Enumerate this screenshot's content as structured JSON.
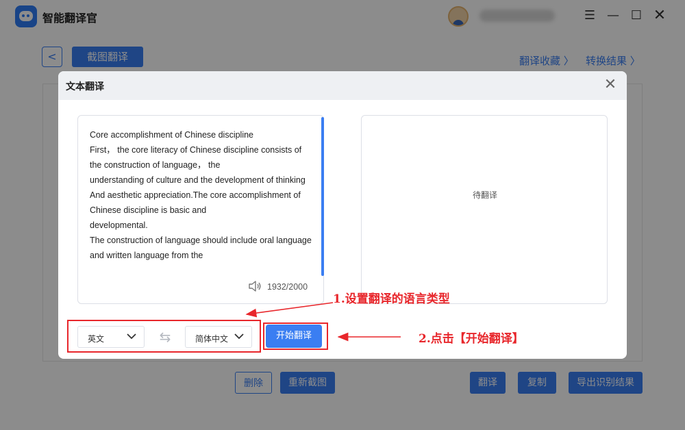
{
  "app": {
    "title": "智能翻译官",
    "window_controls": [
      "menu-icon",
      "minimize-icon",
      "maximize-icon",
      "close-icon"
    ]
  },
  "nav": {
    "back_icon": "chevron-left-icon",
    "back_glyph": "<",
    "active_tab": "截图翻译",
    "links": [
      {
        "label": "翻译收藏 〉"
      },
      {
        "label": "转换结果 〉"
      }
    ]
  },
  "bottom_buttons": {
    "delete": "删除",
    "reshot": "重新截图",
    "translate": "翻译",
    "copy": "复制",
    "export": "导出识别结果"
  },
  "dialog": {
    "title": "文本翻译",
    "close_glyph": "✕",
    "source_text": "Core accomplishment of Chinese discipline\nFirst， the core literacy of Chinese discipline consists of the construction of language， the\nunderstanding of culture and the development of thinking\nAnd aesthetic appreciation.The core accomplishment of Chinese discipline is basic and\ndevelopmental.\nThe construction of language should include oral language and written language from the",
    "char_count": "1932/2000",
    "target_placeholder": "待翻译",
    "source_language": "英文",
    "target_language": "简体中文",
    "swap_glyph": "⇆",
    "start_button": "开始翻译"
  },
  "annotations": {
    "step1": "1.设置翻译的语言类型",
    "step2": "2.点击【开始翻译】",
    "color": "#e8262b"
  },
  "colors": {
    "accent": "#3a7ef2",
    "annotation": "#e8262b"
  }
}
